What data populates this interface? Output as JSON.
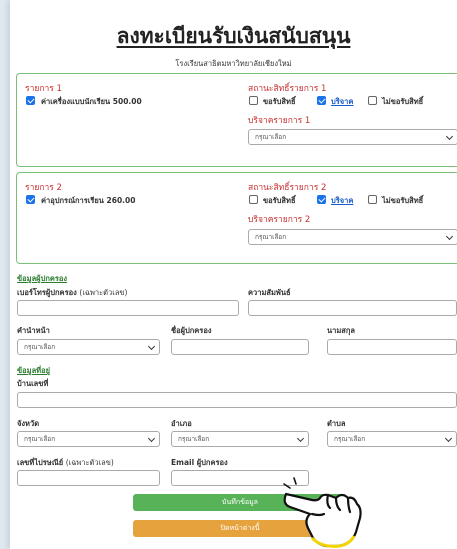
{
  "title": "ลงทะเบียนรับเงินสนับสนุน",
  "subtitle": "โรงเรียนสาธิตมหาวิทยาลัยเชียงใหม่",
  "items": [
    {
      "heading": "รายการ 1",
      "checkbox_label": "ค่าเครื่องแบบนักเรียน 500.00",
      "status_heading": "สถานะสิทธิ์รายการ 1",
      "options": [
        "ขอรับสิทธิ์",
        "บริจาค",
        "ไม่ขอรับสิทธิ์"
      ],
      "donate_heading": "บริจาครายการ 1",
      "select_value": "กรุณาเลือก"
    },
    {
      "heading": "รายการ 2",
      "checkbox_label": "ค่าอุปกรณ์การเรียน 260.00",
      "status_heading": "สถานะสิทธิ์รายการ 2",
      "options": [
        "ขอรับสิทธิ์",
        "บริจาค",
        "ไม่ขอรับสิทธิ์"
      ],
      "donate_heading": "บริจาครายการ 2",
      "select_value": "กรุณาเลือก"
    }
  ],
  "guardian": {
    "section_title": "ข้อมูลผู้ปกครอง",
    "phone_label": "เบอร์โทรผู้ปกครอง",
    "phone_hint": "(เฉพาะตัวเลข)",
    "relation_label": "ความสัมพันธ์",
    "prefix_label": "คำนำหน้า",
    "prefix_select": "กรุณาเลือก",
    "firstname_label": "ชื่อผู้ปกครอง",
    "lastname_label": "นามสกุล"
  },
  "address": {
    "section_title": "ข้อมูลที่อยู่",
    "house_label": "บ้านเลขที่",
    "province_label": "จังหวัด",
    "province_select": "กรุณาเลือก",
    "district_label": "อำเภอ",
    "district_select": "กรุณาเลือก",
    "subdistrict_label": "ตำบล",
    "subdistrict_select": "กรุณาเลือก",
    "postal_label": "เลขที่ไปรษณีย์",
    "postal_hint": "(เฉพาะตัวเลข)",
    "email_label": "Email ผู้ปกครอง"
  },
  "buttons": {
    "save": "บันทึกข้อมูล",
    "back": "ปิดหน้าต่างนี้"
  },
  "colors": {
    "accent_red": "#c8302f",
    "section_green": "#2e7d32",
    "save_button": "#58b358",
    "back_button": "#e6a23c",
    "checkbox_blue": "#1a73e8"
  }
}
